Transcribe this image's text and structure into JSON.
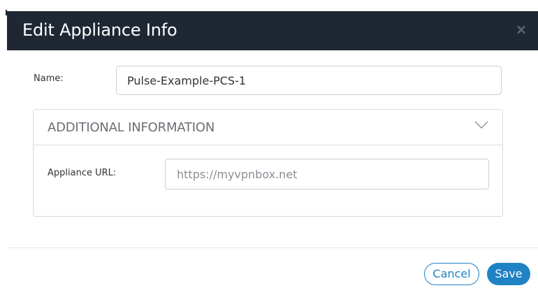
{
  "dialog": {
    "title": "Edit Appliance Info",
    "close_icon": "close-icon",
    "close_glyph": "×"
  },
  "form": {
    "name_label": "Name:",
    "name_value": "Pulse-Example-PCS-1"
  },
  "additional_info": {
    "title": "ADDITIONAL INFORMATION",
    "toggle_icon": "chevron-down-icon",
    "expanded": true,
    "appliance_url_label": "Appliance URL:",
    "appliance_url_value": "",
    "appliance_url_placeholder": "https://myvpnbox.net"
  },
  "footer": {
    "cancel_label": "Cancel",
    "save_label": "Save"
  },
  "colors": {
    "header_bg": "#1f2733",
    "accent": "#1f82c4",
    "border": "#c9ced4",
    "panel_title": "#6b6f75"
  }
}
